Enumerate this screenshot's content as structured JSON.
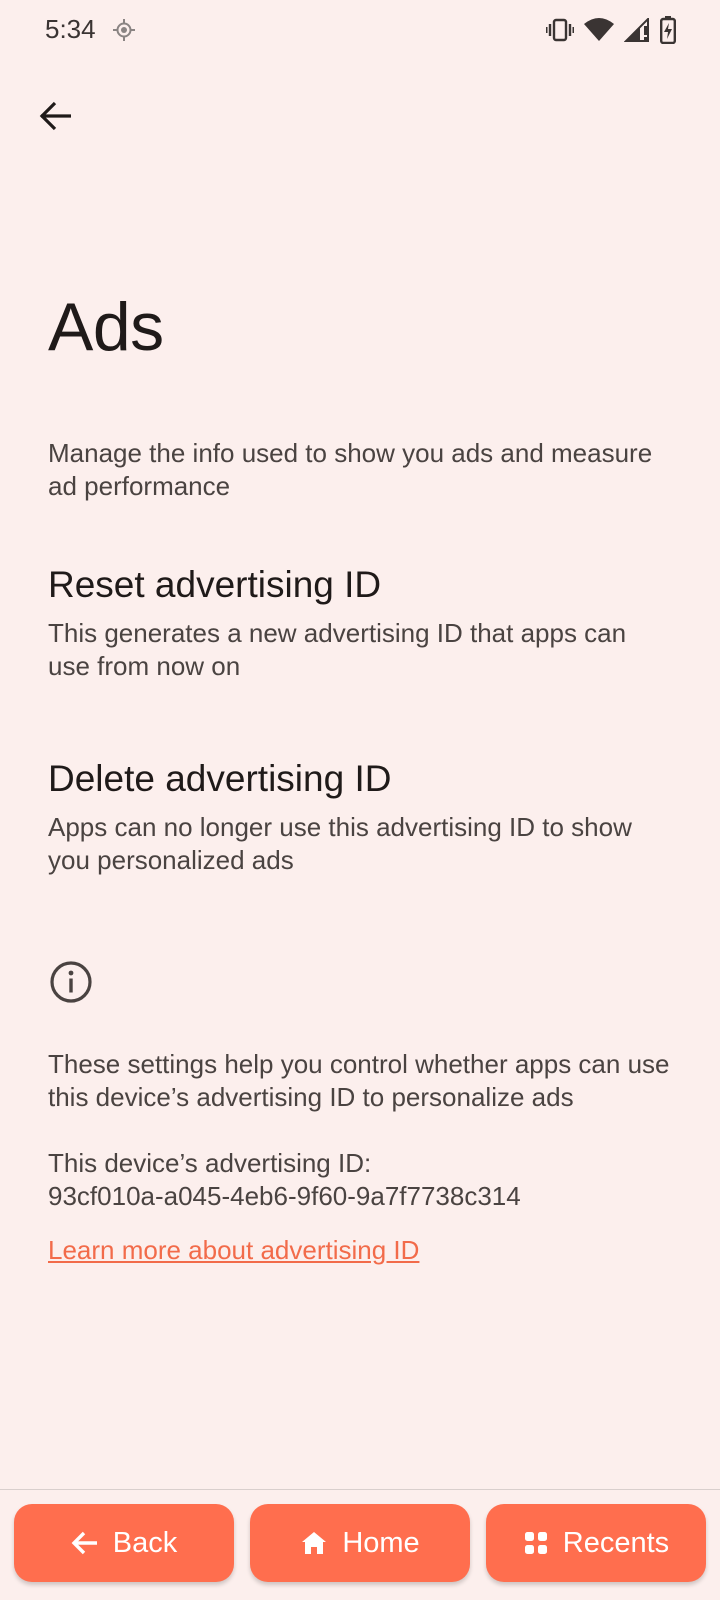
{
  "status_bar": {
    "time": "5:34",
    "icons": [
      "location-icon",
      "vibrate-icon",
      "wifi-icon",
      "signal-icon",
      "battery-charging-icon"
    ]
  },
  "header": {
    "back_icon": "arrow-back-icon"
  },
  "page": {
    "title": "Ads",
    "intro": "Manage the info used to show you ads and measure ad performance"
  },
  "items": [
    {
      "title": "Reset advertising ID",
      "summary": "This generates a new advertising ID that apps can use from now on"
    },
    {
      "title": "Delete advertising ID",
      "summary": "Apps can no longer use this advertising ID to show you personalized ads"
    }
  ],
  "footer": {
    "info_icon": "info-icon",
    "description": "These settings help you control whether apps can use this device’s advertising ID to personalize ads",
    "id_label": "This device’s advertising ID:",
    "id_value": "93cf010a-a045-4eb6-9f60-9a7f7738c314",
    "learn_more": "Learn more about advertising ID"
  },
  "nav": {
    "back_label": "Back",
    "home_label": "Home",
    "recents_label": "Recents"
  },
  "colors": {
    "background": "#fcefed",
    "accent": "#ff6e4e",
    "link": "#f26b4a"
  }
}
